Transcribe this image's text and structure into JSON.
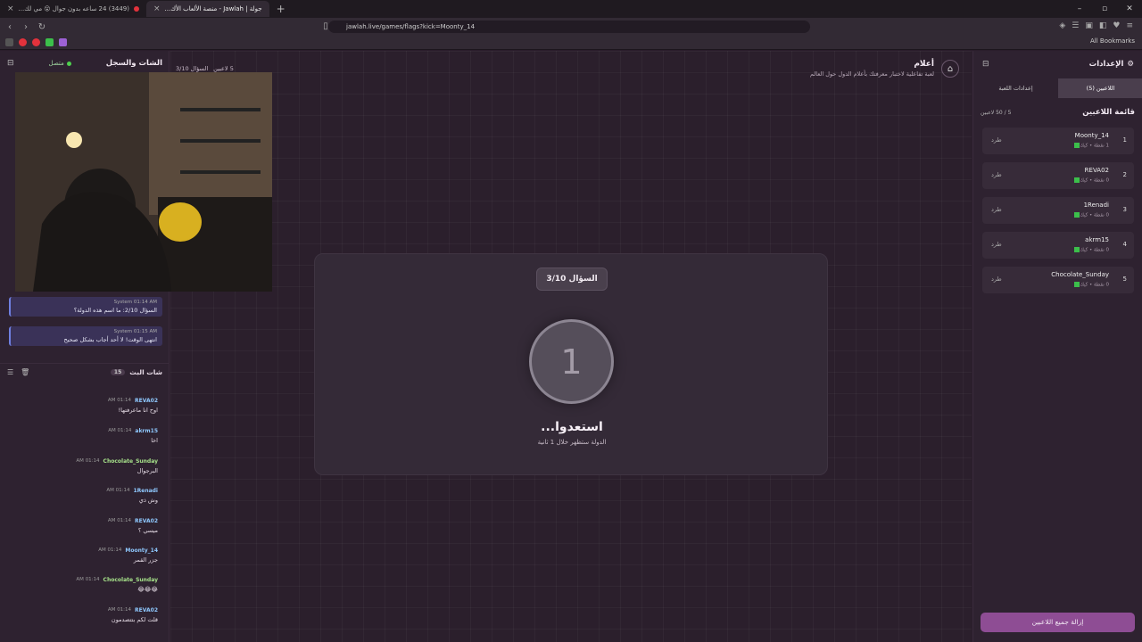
{
  "browser": {
    "tabs": [
      {
        "label": "(3449) 24 ساعه بدون جوال 😮 مي لك..."
      },
      {
        "label": "جولة | Jawlah - منصة الألعاب الأك..."
      }
    ],
    "url": "jawlah.live/games/flags?kick=Moonty_14",
    "all_bookmarks": "All Bookmarks",
    "colors": {
      "red": "#e2323c",
      "green": "#3cbf4b",
      "purple": "#9c61d4"
    }
  },
  "left_panel": {
    "title": "الشات والسجل",
    "status": "متصل",
    "system_messages": [
      {
        "user": "System",
        "time": "01:14 AM",
        "text": "السؤال 2/10: ما اسم هذه الدولة؟"
      },
      {
        "user": "System",
        "time": "01:15 AM",
        "text": "انتهى الوقت! لا أحد أجاب بشكل صحيح"
      }
    ],
    "bot_chat": {
      "title": "شات البث",
      "count": "15"
    },
    "messages": [
      {
        "user": "REVA02",
        "time": "01:14 AM",
        "text": "اوح انا ماعرفتها!"
      },
      {
        "user": "akrm15",
        "time": "01:14 AM",
        "text": "اخا"
      },
      {
        "user": "Chocolate_Sunday",
        "time": "01:14 AM",
        "text": "البرجوال"
      },
      {
        "user": "1Renadi",
        "time": "01:14 AM",
        "text": "وش ذي"
      },
      {
        "user": "REVA02",
        "time": "01:14 AM",
        "text": "ميسي ؟"
      },
      {
        "user": "Moonty_14",
        "time": "01:14 AM",
        "text": "جزر القمر"
      },
      {
        "user": "Chocolate_Sunday",
        "time": "01:14 AM",
        "text": "😂😂😂"
      },
      {
        "user": "REVA02",
        "time": "01:14 AM",
        "text": "قلت لكم بتتصدمون"
      }
    ]
  },
  "main": {
    "title": "أعلام",
    "subtitle": "لعبة تفاعلية لاختبار معرفتك بأعلام الدول حول العالم",
    "players_info": "5 لاعبين",
    "question_info": "السؤال 3/10",
    "question_pill": "السؤال 3/10",
    "countdown": "1",
    "ready_title": "استعدوا...",
    "ready_sub": "الدولة ستظهر خلال 1 ثانية"
  },
  "right_panel": {
    "title": "الإعدادات",
    "tab_players": "اللاعبين (5)",
    "tab_settings": "إعدادات اللعبة",
    "players_title": "قائمة اللاعبين",
    "players_count": "5 / 50 لاعبين",
    "kick_label": "طرد",
    "players": [
      {
        "rank": "1",
        "name": "Moonty_14",
        "score": "1 نقطة • كيك"
      },
      {
        "rank": "2",
        "name": "REVA02",
        "score": "0 نقطة • كيك"
      },
      {
        "rank": "3",
        "name": "1Renadi",
        "score": "0 نقطة • كيك"
      },
      {
        "rank": "4",
        "name": "akrm15",
        "score": "0 نقطة • كيك"
      },
      {
        "rank": "5",
        "name": "Chocolate_Sunday",
        "score": "0 نقطة • كيك"
      }
    ],
    "clear_button": "إزالة جميع اللاعبين"
  }
}
